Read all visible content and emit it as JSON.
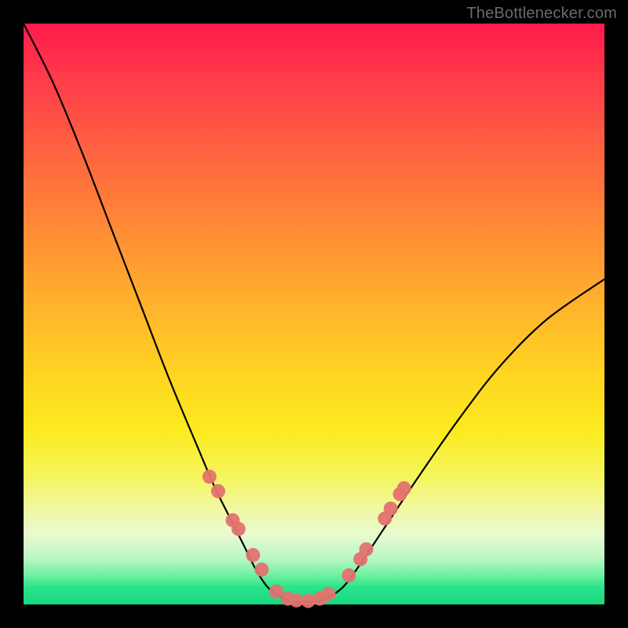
{
  "watermark": "TheBottlenecker.com",
  "chart_data": {
    "type": "line",
    "title": "",
    "xlabel": "",
    "ylabel": "",
    "xlim": [
      0,
      1
    ],
    "ylim": [
      0,
      1
    ],
    "series": [
      {
        "name": "bottleneck-curve",
        "x": [
          0.0,
          0.05,
          0.1,
          0.15,
          0.2,
          0.25,
          0.3,
          0.33,
          0.36,
          0.38,
          0.4,
          0.42,
          0.44,
          0.46,
          0.48,
          0.5,
          0.52,
          0.55,
          0.58,
          0.62,
          0.68,
          0.75,
          0.82,
          0.9,
          1.0
        ],
        "y": [
          1.0,
          0.9,
          0.78,
          0.65,
          0.52,
          0.39,
          0.27,
          0.2,
          0.14,
          0.1,
          0.06,
          0.03,
          0.015,
          0.005,
          0.005,
          0.005,
          0.01,
          0.03,
          0.07,
          0.13,
          0.22,
          0.32,
          0.41,
          0.49,
          0.56
        ]
      }
    ],
    "markers": {
      "name": "compatibility-markers",
      "color": "#e2736f",
      "points": [
        {
          "x": 0.32,
          "y": 0.22
        },
        {
          "x": 0.335,
          "y": 0.195
        },
        {
          "x": 0.36,
          "y": 0.145
        },
        {
          "x": 0.37,
          "y": 0.13
        },
        {
          "x": 0.395,
          "y": 0.085
        },
        {
          "x": 0.41,
          "y": 0.06
        },
        {
          "x": 0.435,
          "y": 0.022
        },
        {
          "x": 0.455,
          "y": 0.01
        },
        {
          "x": 0.47,
          "y": 0.007
        },
        {
          "x": 0.49,
          "y": 0.006
        },
        {
          "x": 0.51,
          "y": 0.01
        },
        {
          "x": 0.525,
          "y": 0.018
        },
        {
          "x": 0.56,
          "y": 0.05
        },
        {
          "x": 0.58,
          "y": 0.078
        },
        {
          "x": 0.59,
          "y": 0.095
        },
        {
          "x": 0.622,
          "y": 0.148
        },
        {
          "x": 0.632,
          "y": 0.165
        },
        {
          "x": 0.648,
          "y": 0.19
        },
        {
          "x": 0.655,
          "y": 0.2
        }
      ]
    },
    "gradient_stops": [
      {
        "pos": 0.0,
        "color": "#ff1a4b"
      },
      {
        "pos": 0.5,
        "color": "#ffd322"
      },
      {
        "pos": 0.8,
        "color": "#f5f55e"
      },
      {
        "pos": 1.0,
        "color": "#17d880"
      }
    ]
  }
}
